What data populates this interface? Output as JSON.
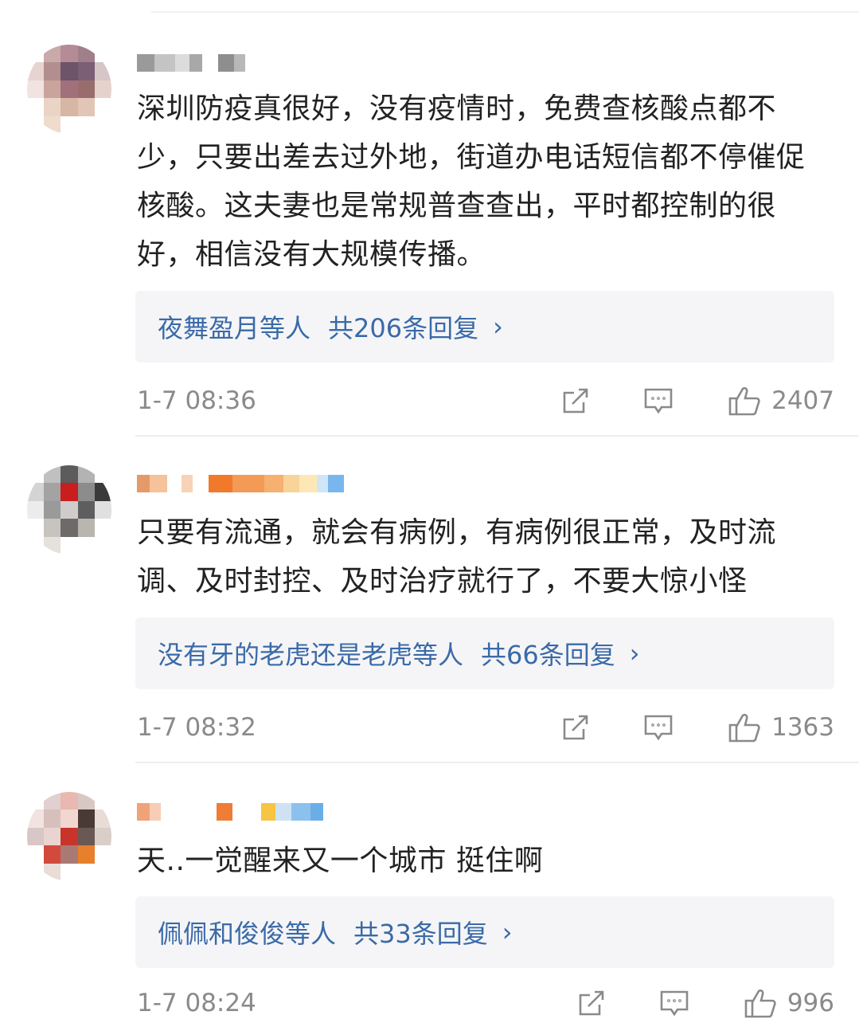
{
  "comments": [
    {
      "text": "深圳防疫真很好，没有疫情时，免费查核酸点都不少，只要出差去过外地，街道办电话短信都不停催促核酸。这夫妻也是常规普查查出，平时都控制的很好，相信没有大规模传播。",
      "reply_who": "夜舞盈月等人",
      "reply_count": "共206条回复",
      "time": "1-7 08:36",
      "likes": "2407"
    },
    {
      "text": "只要有流通，就会有病例，有病例很正常，及时流调、及时封控、及时治疗就行了，不要大惊小怪",
      "reply_who": "没有牙的老虎还是老虎等人",
      "reply_count": "共66条回复",
      "time": "1-7 08:32",
      "likes": "1363"
    },
    {
      "text": "天..一觉醒来又一个城市 挺住啊",
      "reply_who": "佩佩和俊俊等人",
      "reply_count": "共33条回复",
      "time": "1-7 08:24",
      "likes": "996"
    }
  ],
  "icons": {
    "share": "share-icon",
    "comment": "comment-icon",
    "like": "like-icon",
    "chevron": "chevron-right-icon"
  },
  "colors": {
    "link": "#3a6aa8",
    "meta": "#8a8a8a",
    "reply_bg": "#f5f5f7"
  }
}
